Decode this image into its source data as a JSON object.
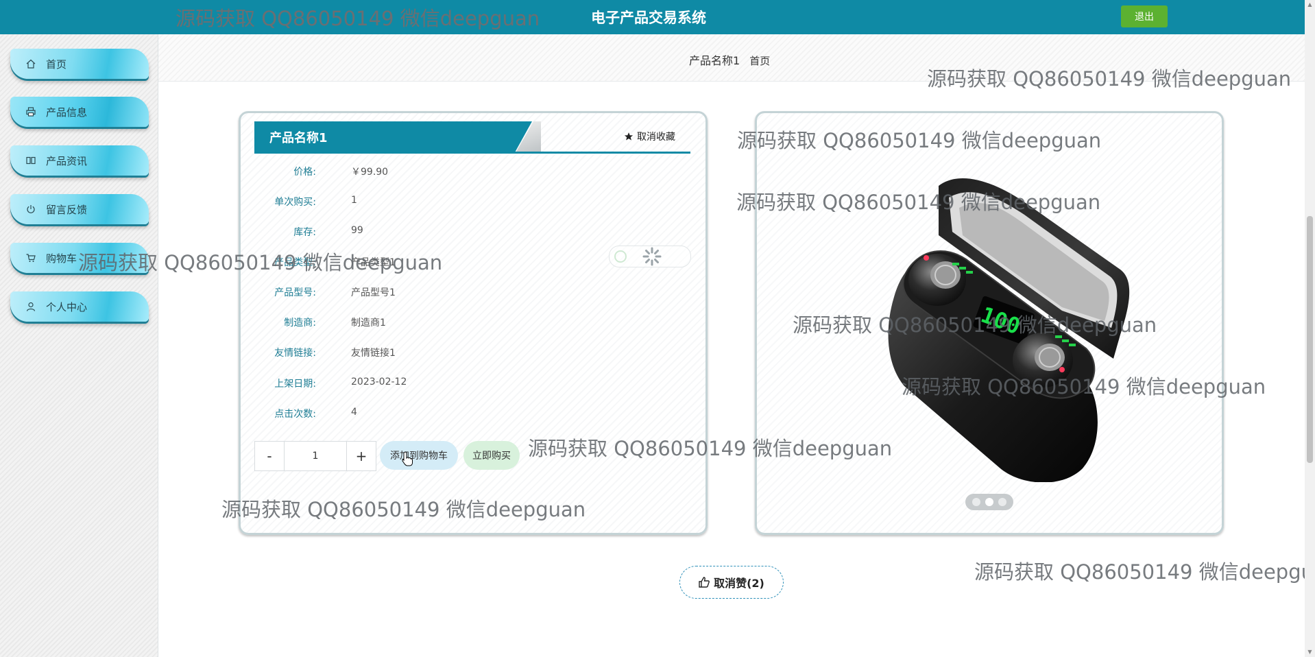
{
  "header": {
    "title": "电子产品交易系统",
    "logout": "退出"
  },
  "sidebar": {
    "items": [
      {
        "label": "首页",
        "icon": "home-icon"
      },
      {
        "label": "产品信息",
        "icon": "print-icon"
      },
      {
        "label": "产品资讯",
        "icon": "book-icon"
      },
      {
        "label": "留言反馈",
        "icon": "power-icon"
      },
      {
        "label": "购物车",
        "icon": "cart-icon"
      },
      {
        "label": "个人中心",
        "icon": "user-icon"
      }
    ]
  },
  "breadcrumb": {
    "current": "产品名称1",
    "home": "首页"
  },
  "product": {
    "name": "产品名称1",
    "favorite": "取消收藏",
    "fields": [
      {
        "label": "价格:",
        "value": "￥99.90"
      },
      {
        "label": "单次购买:",
        "value": "1"
      },
      {
        "label": "库存:",
        "value": "99"
      },
      {
        "label": "产品类型:",
        "value": "产品类型1"
      },
      {
        "label": "产品型号:",
        "value": "产品型号1"
      },
      {
        "label": "制造商:",
        "value": "制造商1"
      },
      {
        "label": "友情链接:",
        "value": "友情链接1"
      },
      {
        "label": "上架日期:",
        "value": "2023-02-12"
      },
      {
        "label": "点击次数:",
        "value": "4"
      }
    ],
    "quantity": {
      "minus": "-",
      "value": "1",
      "plus": "+"
    },
    "add_to_cart": "添加到购物车",
    "buy_now": "立即购买"
  },
  "carousel": {
    "count": 3,
    "active": 2
  },
  "like": {
    "label": "取消赞(2)"
  },
  "watermark": "源码获取 QQ86050149 微信deepguan",
  "colors": {
    "header": "#0f8aa5",
    "logout": "#5cb131",
    "accent": "#1e7d94"
  }
}
